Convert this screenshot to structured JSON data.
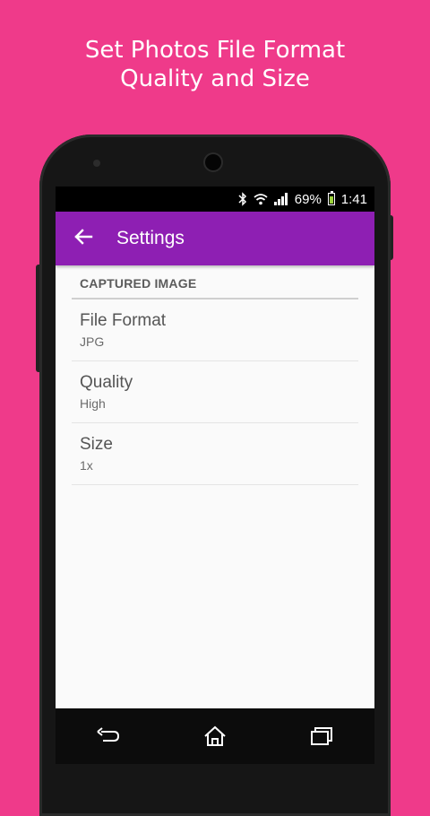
{
  "promo": {
    "line1": "Set Photos File Format",
    "line2": "Quality and Size"
  },
  "statusbar": {
    "icons": [
      "bluetooth-icon",
      "wifi-icon",
      "signal-icon",
      "battery-icon"
    ],
    "battery_percent": "69%",
    "battery_level": 0.69,
    "time": "1:41"
  },
  "appbar": {
    "title": "Settings",
    "color": "#8e1fb3"
  },
  "settings": {
    "section_header": "CAPTURED IMAGE",
    "items": [
      {
        "title": "File Format",
        "summary": "JPG"
      },
      {
        "title": "Quality",
        "summary": "High"
      },
      {
        "title": "Size",
        "summary": "1x"
      }
    ]
  },
  "navbar": {
    "icons": [
      "back-nav-icon",
      "home-icon",
      "recents-icon"
    ]
  },
  "colors": {
    "background": "#ef3a8a",
    "accent": "#8e1fb3"
  }
}
